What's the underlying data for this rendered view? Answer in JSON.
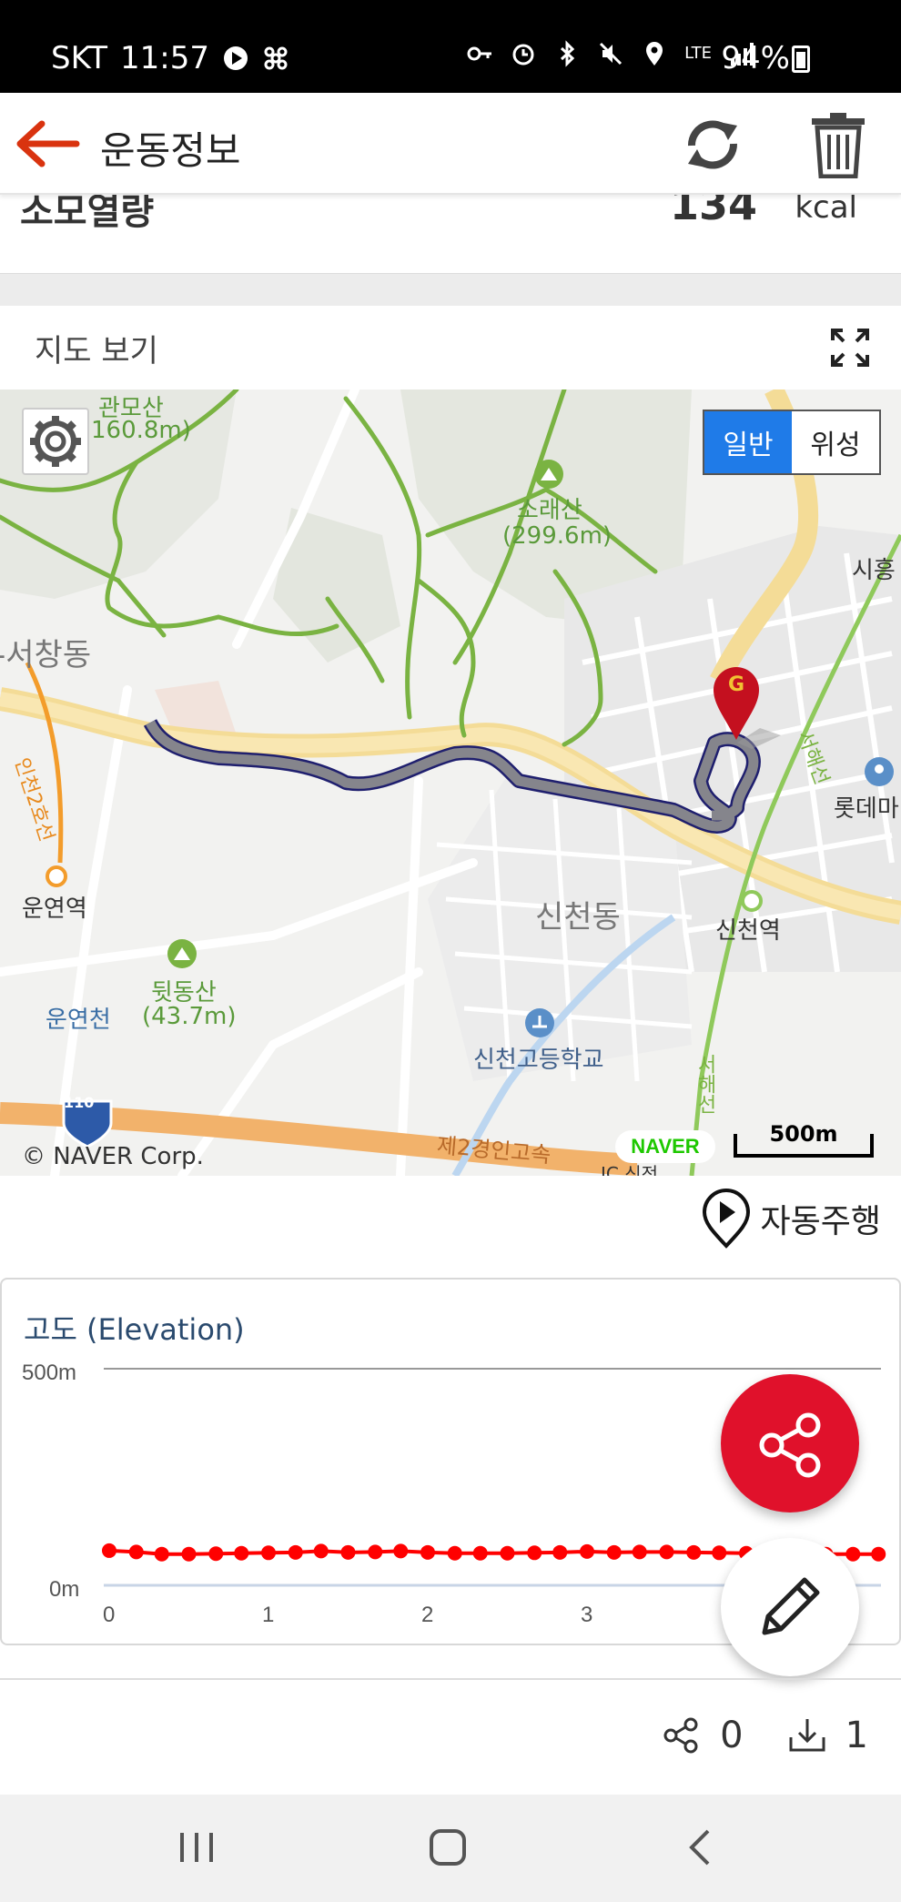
{
  "status_bar": {
    "carrier": "SKT",
    "time": "11:57",
    "network": "LTE",
    "battery": "94%"
  },
  "header": {
    "title": "운동정보"
  },
  "calories": {
    "label": "소모열량",
    "value": "134",
    "unit": "kcal"
  },
  "map_section": {
    "title": "지도 보기",
    "maptype": {
      "normal": "일반",
      "satellite": "위성",
      "selected": "일반"
    },
    "labels": {
      "gwanmosan": "관모산",
      "gwanmosan_h": "160.8m)",
      "soraesan": "소래산",
      "soraesan_h": "(299.6m)",
      "siheung": "시흥",
      "seochangdong": "-서창동",
      "line2": "인천2호선",
      "unyeon_station": "운연역",
      "dwitdongsan": "뒷동산",
      "dwitdongsan_h": "(43.7m)",
      "unyeoncheon": "운연천",
      "sincheondong": "신천동",
      "sincheon_station": "신천역",
      "school": "신천고등학교",
      "lotte": "롯데마",
      "seohaeseon_top": "서해선",
      "seohaeseon_bottom": "서해선",
      "expressway": "제2경인고속",
      "route110": "110",
      "ic": "IC 신전",
      "goal_marker": "G"
    },
    "copyright": "© NAVER Corp.",
    "naver": "NAVER",
    "scale": "500m"
  },
  "autodrive": {
    "label": "자동주행"
  },
  "elevation": {
    "title": "고도 (Elevation)"
  },
  "counts": {
    "shares": "0",
    "downloads": "1"
  },
  "colors": {
    "accent_red": "#e0112b",
    "route": "#7d7d85",
    "elevation_line": "#ff0000"
  },
  "chart_data": {
    "type": "line",
    "title": "고도 (Elevation)",
    "xlabel": "",
    "ylabel": "",
    "ytick_labels": [
      "0m",
      "500m"
    ],
    "ylim": [
      0,
      500
    ],
    "xlim": [
      0,
      4.8
    ],
    "xticks": [
      0,
      1,
      2,
      3
    ],
    "series": [
      {
        "values": [
          [
            0.0,
            80
          ],
          [
            0.17,
            77
          ],
          [
            0.33,
            72
          ],
          [
            0.5,
            72
          ],
          [
            0.67,
            73
          ],
          [
            0.83,
            74
          ],
          [
            1.0,
            75
          ],
          [
            1.17,
            76
          ],
          [
            1.33,
            79
          ],
          [
            1.5,
            76
          ],
          [
            1.67,
            77
          ],
          [
            1.83,
            79
          ],
          [
            2.0,
            76
          ],
          [
            2.17,
            74
          ],
          [
            2.33,
            74
          ],
          [
            2.5,
            74
          ],
          [
            2.67,
            75
          ],
          [
            2.83,
            76
          ],
          [
            3.0,
            78
          ],
          [
            3.17,
            76
          ],
          [
            3.33,
            77
          ],
          [
            3.5,
            77
          ],
          [
            3.67,
            76
          ],
          [
            3.83,
            75
          ],
          [
            4.0,
            74
          ],
          [
            4.17,
            72
          ],
          [
            4.33,
            72
          ],
          [
            4.5,
            72
          ],
          [
            4.67,
            72
          ],
          [
            4.83,
            72
          ]
        ]
      }
    ]
  }
}
